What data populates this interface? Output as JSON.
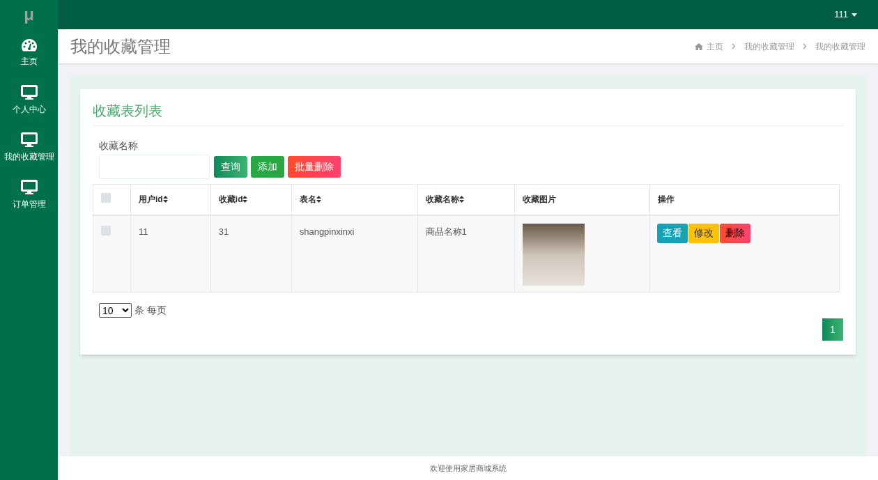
{
  "logo": "μ",
  "user_menu": {
    "label": "111"
  },
  "sidebar": {
    "items": [
      {
        "label": "主页"
      },
      {
        "label": "个人中心"
      },
      {
        "label": "我的收藏管理"
      },
      {
        "label": "订单管理"
      }
    ]
  },
  "page_title": "我的收藏管理",
  "breadcrumb": [
    "主页",
    "我的收藏管理",
    "我的收藏管理"
  ],
  "card_title": "收藏表列表",
  "search": {
    "label": "收藏名称"
  },
  "buttons": [
    {
      "label": "查询",
      "kind": "query"
    },
    {
      "label": "添加",
      "kind": "add"
    },
    {
      "label": "批量删除",
      "kind": "delete"
    }
  ],
  "table": {
    "select_all": {
      "checked": false
    },
    "columns": [
      {
        "label": "用户id",
        "sortable": true
      },
      {
        "label": "收藏id",
        "sortable": true
      },
      {
        "label": "表名",
        "sortable": true
      },
      {
        "label": "收藏名称",
        "sortable": true
      },
      {
        "label": "收藏图片",
        "sortable": false
      },
      {
        "label": "操作",
        "sortable": false
      }
    ],
    "rows": [
      {
        "checked": false,
        "cells": [
          "11",
          "31",
          "shangpinxinxi",
          "商品名称1"
        ],
        "actions": [
          {
            "label": "查看",
            "kind": "view"
          },
          {
            "label": "修改",
            "kind": "edit"
          },
          {
            "label": "删除",
            "kind": "delete"
          }
        ]
      }
    ]
  },
  "page_size": {
    "value": "10",
    "suffix": "条 每页"
  },
  "pagination": [
    {
      "label": "1",
      "selected": true
    }
  ],
  "footer": "欢迎使用家居商城系统"
}
